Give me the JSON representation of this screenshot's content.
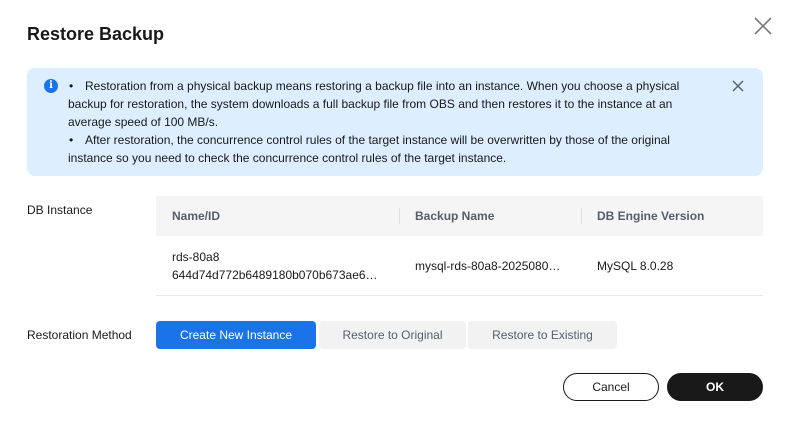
{
  "dialog": {
    "title": "Restore Backup",
    "info": {
      "bullet": "•",
      "line1": "Restoration from a physical backup means restoring a backup file into an instance. When you choose a physical backup for restoration, the system downloads a full backup file from OBS and then restores it to the instance at an average speed of 100 MB/s.",
      "line2": "After restoration, the concurrence control rules of the target instance will be overwritten by those of the original instance so you need to check the concurrence control rules of the target instance."
    },
    "db_instance_label": "DB Instance",
    "table": {
      "headers": [
        "Name/ID",
        "Backup Name",
        "DB Engine Version"
      ],
      "rows": [
        {
          "name": "rds-80a8",
          "id": "644d74d772b6489180b070b673ae6…",
          "backup_name": "mysql-rds-80a8-2025080…",
          "engine_version": "MySQL 8.0.28"
        }
      ]
    },
    "restoration_method_label": "Restoration Method",
    "methods": [
      "Create New Instance",
      "Restore to Original",
      "Restore to Existing"
    ],
    "selected_method": "Create New Instance",
    "cancel_label": "Cancel",
    "ok_label": "OK"
  },
  "colors": {
    "accent": "#1a73e8",
    "info_bg": "#dceeff",
    "ok_bg": "#191919"
  },
  "icons": {
    "close": "close-icon",
    "info": "info-icon",
    "info_close": "info-close-icon"
  }
}
